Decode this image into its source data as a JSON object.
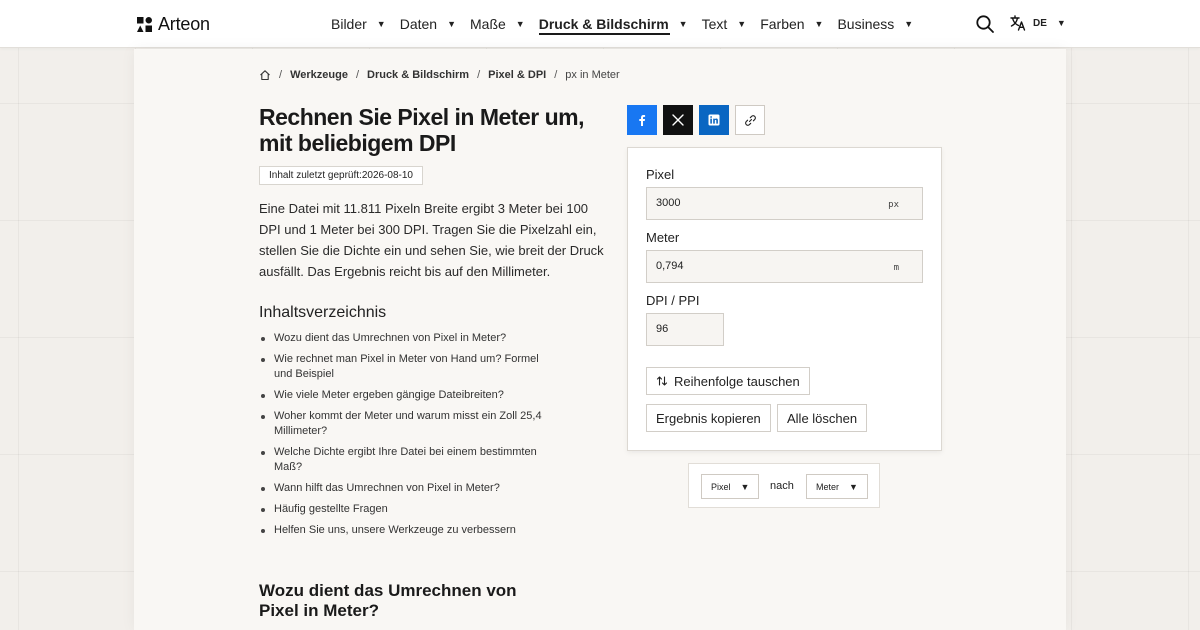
{
  "header": {
    "brand": "Arteon",
    "nav": [
      {
        "label": "Bilder",
        "active": false
      },
      {
        "label": "Daten",
        "active": false
      },
      {
        "label": "Maße",
        "active": false
      },
      {
        "label": "Druck & Bildschirm",
        "active": true
      },
      {
        "label": "Text",
        "active": false
      },
      {
        "label": "Farben",
        "active": false
      },
      {
        "label": "Business",
        "active": false
      }
    ],
    "language": "DE",
    "icons": {
      "search": "search-icon",
      "language": "translate-icon",
      "home": "home-icon"
    }
  },
  "breadcrumb": [
    "Werkzeuge",
    "Druck & Bildschirm",
    "Pixel & DPI",
    "px in Meter"
  ],
  "article": {
    "title": "Rechnen Sie Pixel in Meter um, mit beliebigem DPI",
    "reviewed": "Inhalt zuletzt geprüft:2026-08-10",
    "intro": "Eine Datei mit 11.811 Pixeln Breite ergibt 3 Meter bei 100 DPI und 1 Meter bei 300 DPI. Tragen Sie die Pixelzahl ein, stellen Sie die Dichte ein und sehen Sie, wie breit der Druck ausfällt. Das Ergebnis reicht bis auf den Millimeter.",
    "toc_title": "Inhaltsverzeichnis",
    "toc": [
      "Wozu dient das Umrechnen von Pixel in Meter?",
      "Wie rechnet man Pixel in Meter von Hand um? Formel und Beispiel",
      "Wie viele Meter ergeben gängige Dateibreiten?",
      "Woher kommt der Meter und warum misst ein Zoll 25,4 Millimeter?",
      "Welche Dichte ergibt Ihre Datei bei einem bestimmten Maß?",
      "Wann hilft das Umrechnen von Pixel in Meter?",
      "Häufig gestellte Fragen",
      "Helfen Sie uns, unsere Werkzeuge zu verbessern"
    ],
    "section_title": "Wozu dient das Umrechnen von Pixel in Meter?"
  },
  "share": {
    "facebook": "facebook-icon",
    "x": "x-icon",
    "linkedin": "linkedin-icon",
    "link": "link-icon",
    "colors": {
      "facebook": "#1877f2",
      "x": "#111111",
      "linkedin": "#0a66c2"
    }
  },
  "calculator": {
    "pixel_label": "Pixel",
    "pixel_value": "3000",
    "pixel_unit": "px",
    "meter_label": "Meter",
    "meter_value": "0,794",
    "meter_unit": "m",
    "dpi_label": "DPI / PPI",
    "dpi_value": "96",
    "swap_label": "Reihenfolge tauschen",
    "copy_label": "Ergebnis kopieren",
    "clear_label": "Alle löschen"
  },
  "units": {
    "from": "Pixel",
    "connector": "nach",
    "to": "Meter"
  }
}
